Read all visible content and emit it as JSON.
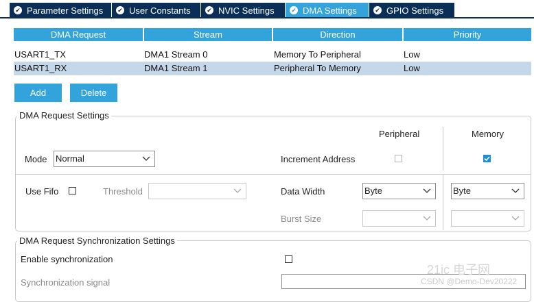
{
  "tabs": [
    {
      "label": "Parameter Settings",
      "active": false
    },
    {
      "label": "User Constants",
      "active": false
    },
    {
      "label": "NVIC Settings",
      "active": false
    },
    {
      "label": "DMA Settings",
      "active": true
    },
    {
      "label": "GPIO Settings",
      "active": false
    }
  ],
  "dma_table": {
    "headers": [
      "DMA Request",
      "Stream",
      "Direction",
      "Priority"
    ],
    "rows": [
      {
        "request": "USART1_TX",
        "stream": "DMA1 Stream 0",
        "direction": "Memory To Peripheral",
        "priority": "Low",
        "selected": false
      },
      {
        "request": "USART1_RX",
        "stream": "DMA1 Stream 1",
        "direction": "Peripheral To Memory",
        "priority": "Low",
        "selected": true
      }
    ]
  },
  "buttons": {
    "add": "Add",
    "delete": "Delete"
  },
  "request_settings": {
    "title": "DMA Request Settings",
    "col_peripheral": "Peripheral",
    "col_memory": "Memory",
    "mode_label": "Mode",
    "mode_value": "Normal",
    "increment_label": "Increment Address",
    "increment_peripheral": false,
    "increment_memory": true,
    "use_fifo_label": "Use Fifo",
    "use_fifo": false,
    "threshold_label": "Threshold",
    "threshold_value": "",
    "data_width_label": "Data Width",
    "data_width_peripheral": "Byte",
    "data_width_memory": "Byte",
    "burst_size_label": "Burst Size",
    "burst_peripheral": "",
    "burst_memory": ""
  },
  "sync_settings": {
    "title": "DMA Request Synchronization Settings",
    "enable_label": "Enable synchronization",
    "enable": false,
    "signal_label": "Synchronization signal",
    "signal_value": ""
  },
  "watermark": {
    "text": "CSDN @Demo-Dev20222",
    "logo": "21ic 电子网"
  },
  "colors": {
    "tab_bg": "#0b2e57",
    "accent": "#33a3dc",
    "selected_row": "#c5d8ea"
  }
}
